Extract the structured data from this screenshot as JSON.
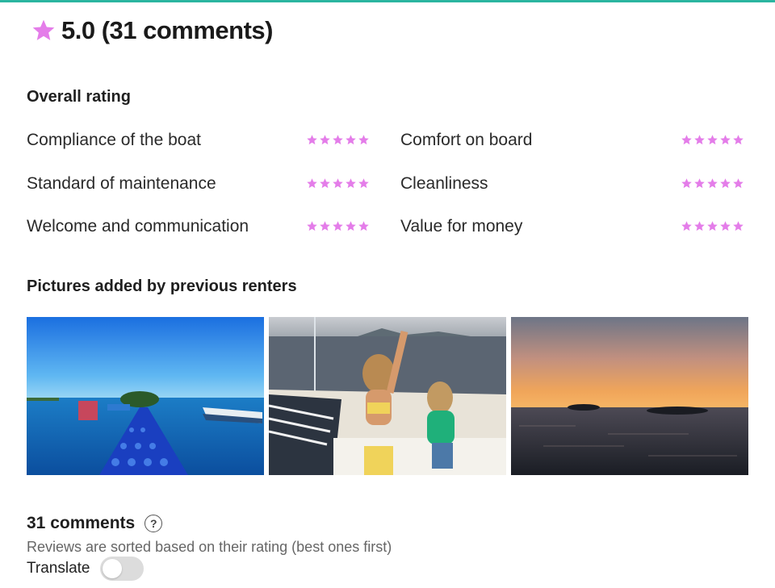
{
  "accent_color": "#e47de9",
  "brand_color": "#2bb5a0",
  "header": {
    "score_text": "5.0 (31 comments)",
    "icon": "star-icon"
  },
  "overall": {
    "title": "Overall rating",
    "criteria": [
      {
        "label": "Compliance of the boat",
        "stars": 5
      },
      {
        "label": "Comfort on board",
        "stars": 5
      },
      {
        "label": "Standard of maintenance",
        "stars": 5
      },
      {
        "label": "Cleanliness",
        "stars": 5
      },
      {
        "label": "Welcome and communication",
        "stars": 5
      },
      {
        "label": "Value for money",
        "stars": 5
      }
    ]
  },
  "pictures": {
    "title": "Pictures added by previous renters",
    "items": [
      {
        "name": "photo-blue-dock"
      },
      {
        "name": "photo-kids-on-deck"
      },
      {
        "name": "photo-sunset-sea"
      }
    ]
  },
  "comments": {
    "title": "31 comments",
    "help_icon": "question-mark-icon",
    "sort_note": "Reviews are sorted based on their rating (best ones first)",
    "translate_label": "Translate",
    "translate_on": false
  }
}
